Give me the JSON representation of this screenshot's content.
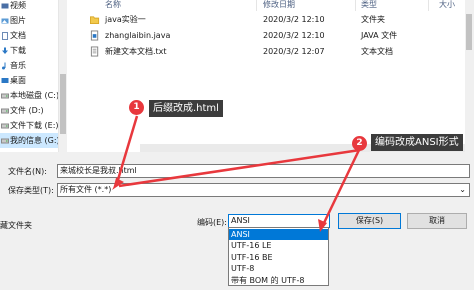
{
  "sidebar": {
    "items": [
      {
        "label": "视频",
        "icon": "video-icon"
      },
      {
        "label": "图片",
        "icon": "picture-icon"
      },
      {
        "label": "文档",
        "icon": "document-icon"
      },
      {
        "label": "下载",
        "icon": "download-icon"
      },
      {
        "label": "音乐",
        "icon": "music-icon"
      },
      {
        "label": "桌面",
        "icon": "desktop-icon"
      },
      {
        "label": "本地磁盘 (C:)",
        "icon": "drive-icon"
      },
      {
        "label": "文件 (D:)",
        "icon": "drive-icon"
      },
      {
        "label": "文件下载 (E:)",
        "icon": "drive-icon"
      },
      {
        "label": "我的信息 (G:)",
        "icon": "drive-icon"
      }
    ],
    "selected_index": 9
  },
  "columns": {
    "name": "名称",
    "modified": "修改日期",
    "type": "类型",
    "size": "大小"
  },
  "files": [
    {
      "name": "java实验一",
      "modified": "2020/3/2 12:10",
      "type": "文件夹",
      "icon": "folder-icon"
    },
    {
      "name": "zhanglaibin.java",
      "modified": "2020/3/2 12:10",
      "type": "JAVA 文件",
      "icon": "java-file-icon"
    },
    {
      "name": "新建文本文档.txt",
      "modified": "2020/3/2 12:07",
      "type": "文本文档",
      "icon": "text-file-icon"
    }
  ],
  "form": {
    "filename_label": "文件名(N):",
    "filename_value": "来城校长是我叔.html",
    "savetype_label": "保存类型(T):",
    "savetype_value": "所有文件 (*.*)",
    "hide_folders_label": "藏文件夹",
    "encoding_label": "编码(E):",
    "encoding_value": "ANSI",
    "save_button": "保存(S)",
    "cancel_button": "取消"
  },
  "encoding_options": [
    "ANSI",
    "UTF-16 LE",
    "UTF-16 BE",
    "UTF-8",
    "带有 BOM 的 UTF-8"
  ],
  "encoding_selected_index": 0,
  "annotations": [
    {
      "badge": "1",
      "text": "后缀改成.html"
    },
    {
      "badge": "2",
      "text": "编码改成ANSI形式"
    }
  ],
  "colors": {
    "accent": "#0078d7",
    "selection": "#cce8ff",
    "annotation_red": "#e8383d",
    "callout_bg": "#3c3c3c"
  }
}
